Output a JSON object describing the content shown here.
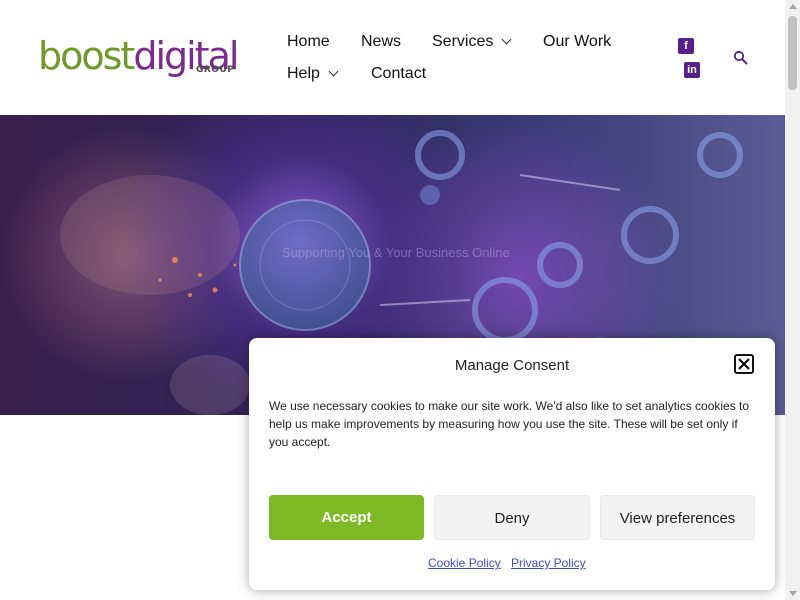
{
  "brand": {
    "logo_part1": "boost",
    "logo_part2": "digital",
    "logo_sub": "GROUP",
    "green": "#6f9a2b",
    "purple": "#7b2a8f"
  },
  "nav": {
    "items": [
      {
        "label": "Home"
      },
      {
        "label": "News"
      },
      {
        "label": "Services",
        "has_dropdown": true
      },
      {
        "label": "Our Work"
      },
      {
        "label": "Help",
        "has_dropdown": true
      },
      {
        "label": "Contact"
      }
    ]
  },
  "social": {
    "facebook_icon": "facebook-icon",
    "linkedin_icon": "linkedin-icon",
    "color": "#5b1f8a"
  },
  "search": {
    "icon": "search-icon"
  },
  "hero": {
    "text": "Supporting You & Your Business Online"
  },
  "consent": {
    "title": "Manage Consent",
    "message": "We use necessary cookies to make our site work. We'd also like to set analytics cookies to help us make improvements by measuring how you use the site. These will be set only if you accept.",
    "accept_label": "Accept",
    "deny_label": "Deny",
    "prefs_label": "View preferences",
    "cookie_policy": "Cookie Policy",
    "privacy_policy": "Privacy Policy",
    "accept_color": "#7cb924"
  }
}
